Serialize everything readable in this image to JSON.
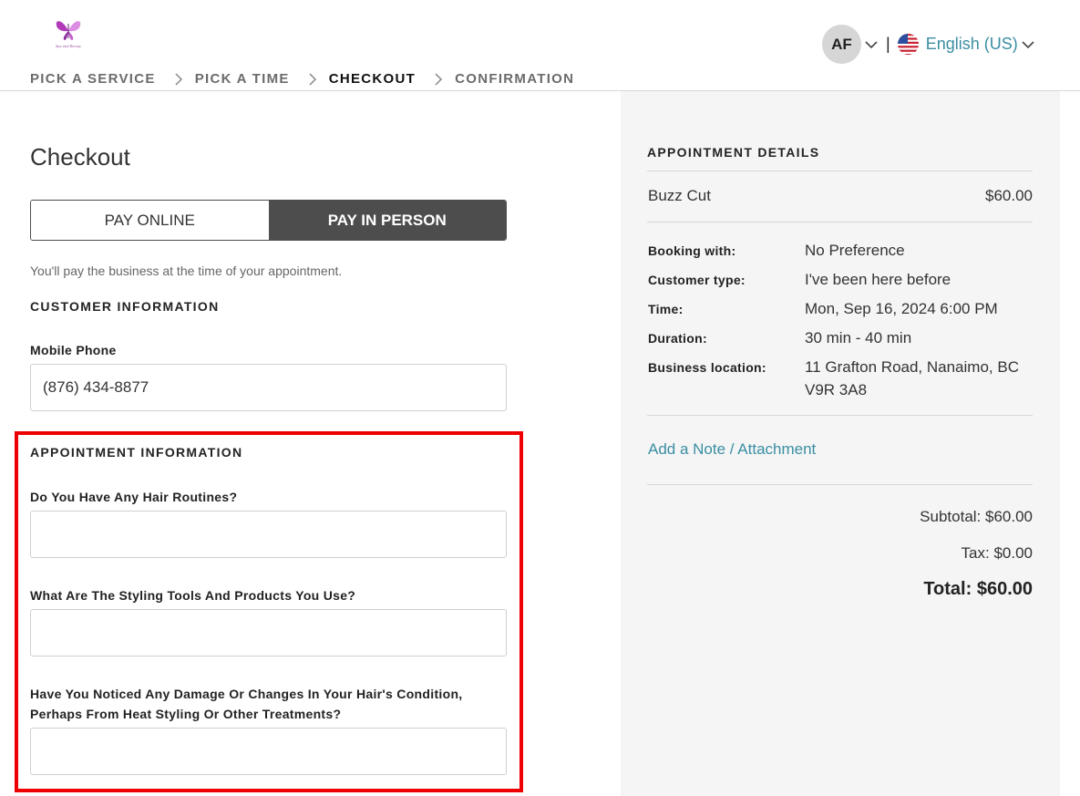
{
  "header": {
    "avatar_initials": "AF",
    "separator": "|",
    "language": "English (US)"
  },
  "breadcrumb": [
    "PICK A SERVICE",
    "PICK A TIME",
    "CHECKOUT",
    "CONFIRMATION"
  ],
  "checkout": {
    "title": "Checkout",
    "pay_online": "PAY ONLINE",
    "pay_in_person": "PAY IN PERSON",
    "selected_payment": "PAY IN PERSON",
    "pay_note": "You'll pay the business at the time of your appointment."
  },
  "customer_info": {
    "heading": "CUSTOMER INFORMATION",
    "phone_label": "Mobile Phone",
    "phone_value": "(876) 434-8877"
  },
  "appointment_info": {
    "heading": "APPOINTMENT INFORMATION",
    "q1_label": "Do You Have Any Hair Routines?",
    "q1_value": "",
    "q2_label": "What Are The Styling Tools And Products You Use?",
    "q2_value": "",
    "q3_label_line1": "Have You Noticed Any Damage Or Changes In Your Hair's Condition,",
    "q3_label_line2": "Perhaps From Heat Styling Or Other Treatments?",
    "q3_value": ""
  },
  "details": {
    "heading": "APPOINTMENT DETAILS",
    "service_name": "Buzz Cut",
    "service_price": "$60.00",
    "booking_with_label": "Booking with:",
    "booking_with": "No Preference",
    "customer_type_label": "Customer type:",
    "customer_type": "I've been here before",
    "time_label": "Time:",
    "time": "Mon, Sep 16, 2024 6:00 PM",
    "duration_label": "Duration:",
    "duration": "30 min - 40 min",
    "location_label": "Business location:",
    "location_line1": "11 Grafton Road, Nanaimo, BC",
    "location_line2": "V9R 3A8",
    "note_link": "Add a Note / Attachment",
    "subtotal": "Subtotal: $60.00",
    "tax": "Tax: $0.00",
    "total": "Total: $60.00"
  },
  "colors": {
    "accent": "#3a8ea3",
    "toggle_active": "#4d4d4d",
    "highlight": "#ee0000",
    "panel_bg": "#f5f5f5"
  }
}
